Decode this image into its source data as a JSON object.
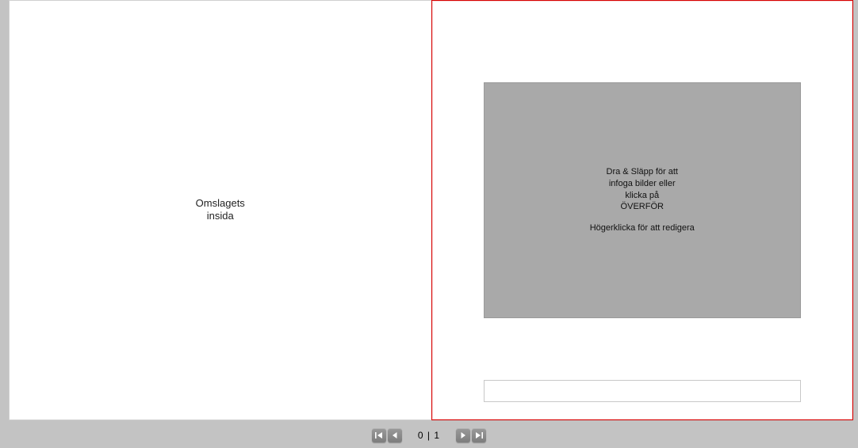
{
  "left_page": {
    "label_line1": "Omslagets",
    "label_line2": "insida"
  },
  "right_page": {
    "drop_area": {
      "line1": "Dra & Släpp för att",
      "line2": "infoga bilder eller",
      "line3": "klicka på",
      "line4": "ÖVERFÖR",
      "line5": "Högerklicka för att redigera"
    },
    "text_field_value": ""
  },
  "nav": {
    "page_display": "0 | 1"
  }
}
